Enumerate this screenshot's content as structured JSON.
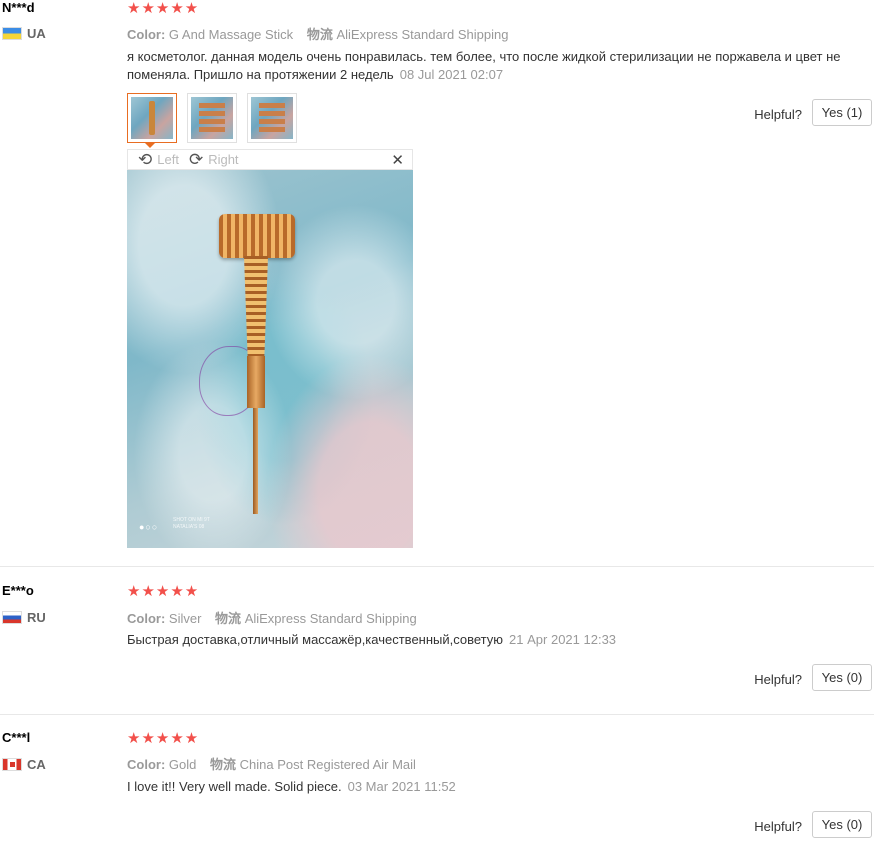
{
  "reviews": [
    {
      "user": "N***d",
      "country": "UA",
      "stars": "★★★★★",
      "color_label": "Color:",
      "color_value": "G And Massage Stick",
      "shipping_label": "物流",
      "shipping_value": "AliExpress Standard Shipping",
      "text": "я косметолог. данная модель очень понравилась. тем более, что после жидкой стерилизации не поржавела и цвет не поменяла. Пришло на протяжении 2 недель",
      "date": "08 Jul 2021 02:07",
      "helpful_label": "Helpful?",
      "yes_label": "Yes (1)",
      "viewer": {
        "left_label": "Left",
        "right_label": "Right",
        "rotate_left_icon": "rotate-left-icon",
        "rotate_right_icon": "rotate-right-icon",
        "close_icon": "close-icon",
        "dots": "●○○",
        "watermark_line1": "SHOT ON MI 9T",
        "watermark_line2": "NATALIA'S 08"
      }
    },
    {
      "user": "E***o",
      "country": "RU",
      "stars": "★★★★★",
      "color_label": "Color:",
      "color_value": "Silver",
      "shipping_label": "物流",
      "shipping_value": "AliExpress Standard Shipping",
      "text": "Быстрая доставка,отличный массажёр,качественный,советую",
      "date": "21 Apr 2021 12:33",
      "helpful_label": "Helpful?",
      "yes_label": "Yes (0)"
    },
    {
      "user": "C***l",
      "country": "CA",
      "stars": "★★★★★",
      "color_label": "Color:",
      "color_value": "Gold",
      "shipping_label": "物流",
      "shipping_value": "China Post Registered Air Mail",
      "text": "I love it!! Very well made. Solid piece.",
      "date": "03 Mar 2021 11:52",
      "helpful_label": "Helpful?",
      "yes_label": "Yes (0)"
    }
  ],
  "colors": {
    "star": "#f2504b",
    "active_thumb_border": "#e86d22",
    "meta_text": "#999999"
  }
}
